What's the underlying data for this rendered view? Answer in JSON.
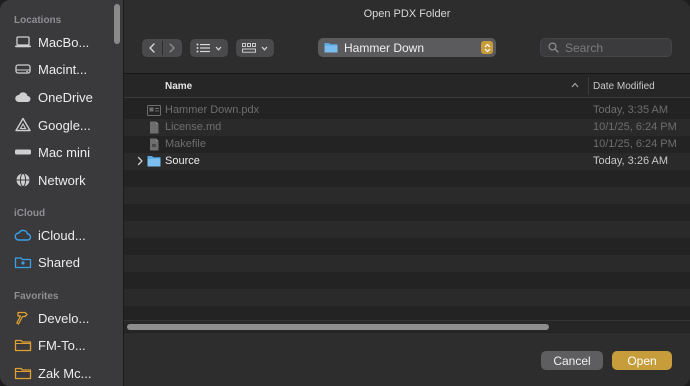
{
  "window": {
    "title": "Open PDX Folder"
  },
  "sidebar": {
    "sections": [
      {
        "label": "Locations",
        "items": [
          {
            "label": "MacBo...",
            "icon": "laptop-icon"
          },
          {
            "label": "Macint...",
            "icon": "disk-icon"
          },
          {
            "label": "OneDrive",
            "icon": "cloud-icon"
          },
          {
            "label": "Google...",
            "icon": "drive-icon"
          },
          {
            "label": "Mac mini",
            "icon": "mac-mini-icon"
          },
          {
            "label": "Network",
            "icon": "globe-icon"
          }
        ]
      },
      {
        "label": "iCloud",
        "items": [
          {
            "label": "iCloud...",
            "icon": "icloud-icon"
          },
          {
            "label": "Shared",
            "icon": "shared-folder-icon"
          }
        ]
      },
      {
        "label": "Favorites",
        "items": [
          {
            "label": "Develo...",
            "icon": "hammer-icon"
          },
          {
            "label": "FM-To...",
            "icon": "folder-icon"
          },
          {
            "label": "Zak Mc...",
            "icon": "folder-icon"
          }
        ]
      }
    ]
  },
  "toolbar": {
    "path_label": "Hammer Down",
    "search_placeholder": "Search"
  },
  "columns": {
    "name": "Name",
    "date": "Date Modified"
  },
  "files": [
    {
      "name": "Hammer Down.pdx",
      "date": "Today, 3:35 AM",
      "icon": "pdx-file-icon",
      "enabled": false,
      "folder": false
    },
    {
      "name": "License.md",
      "date": "10/1/25, 6:24 PM",
      "icon": "document-icon",
      "enabled": false,
      "folder": false
    },
    {
      "name": "Makefile",
      "date": "10/1/25, 6:24 PM",
      "icon": "document-icon",
      "enabled": false,
      "folder": false
    },
    {
      "name": "Source",
      "date": "Today, 3:26 AM",
      "icon": "folder-icon",
      "enabled": true,
      "folder": true
    }
  ],
  "buttons": {
    "cancel": "Cancel",
    "open": "Open"
  },
  "colors": {
    "accent": "#c69d3a",
    "folder_blue": "#5aa9e6",
    "sidebar_icon_blue": "#3aa0e8",
    "favorite_orange": "#e0a030"
  }
}
